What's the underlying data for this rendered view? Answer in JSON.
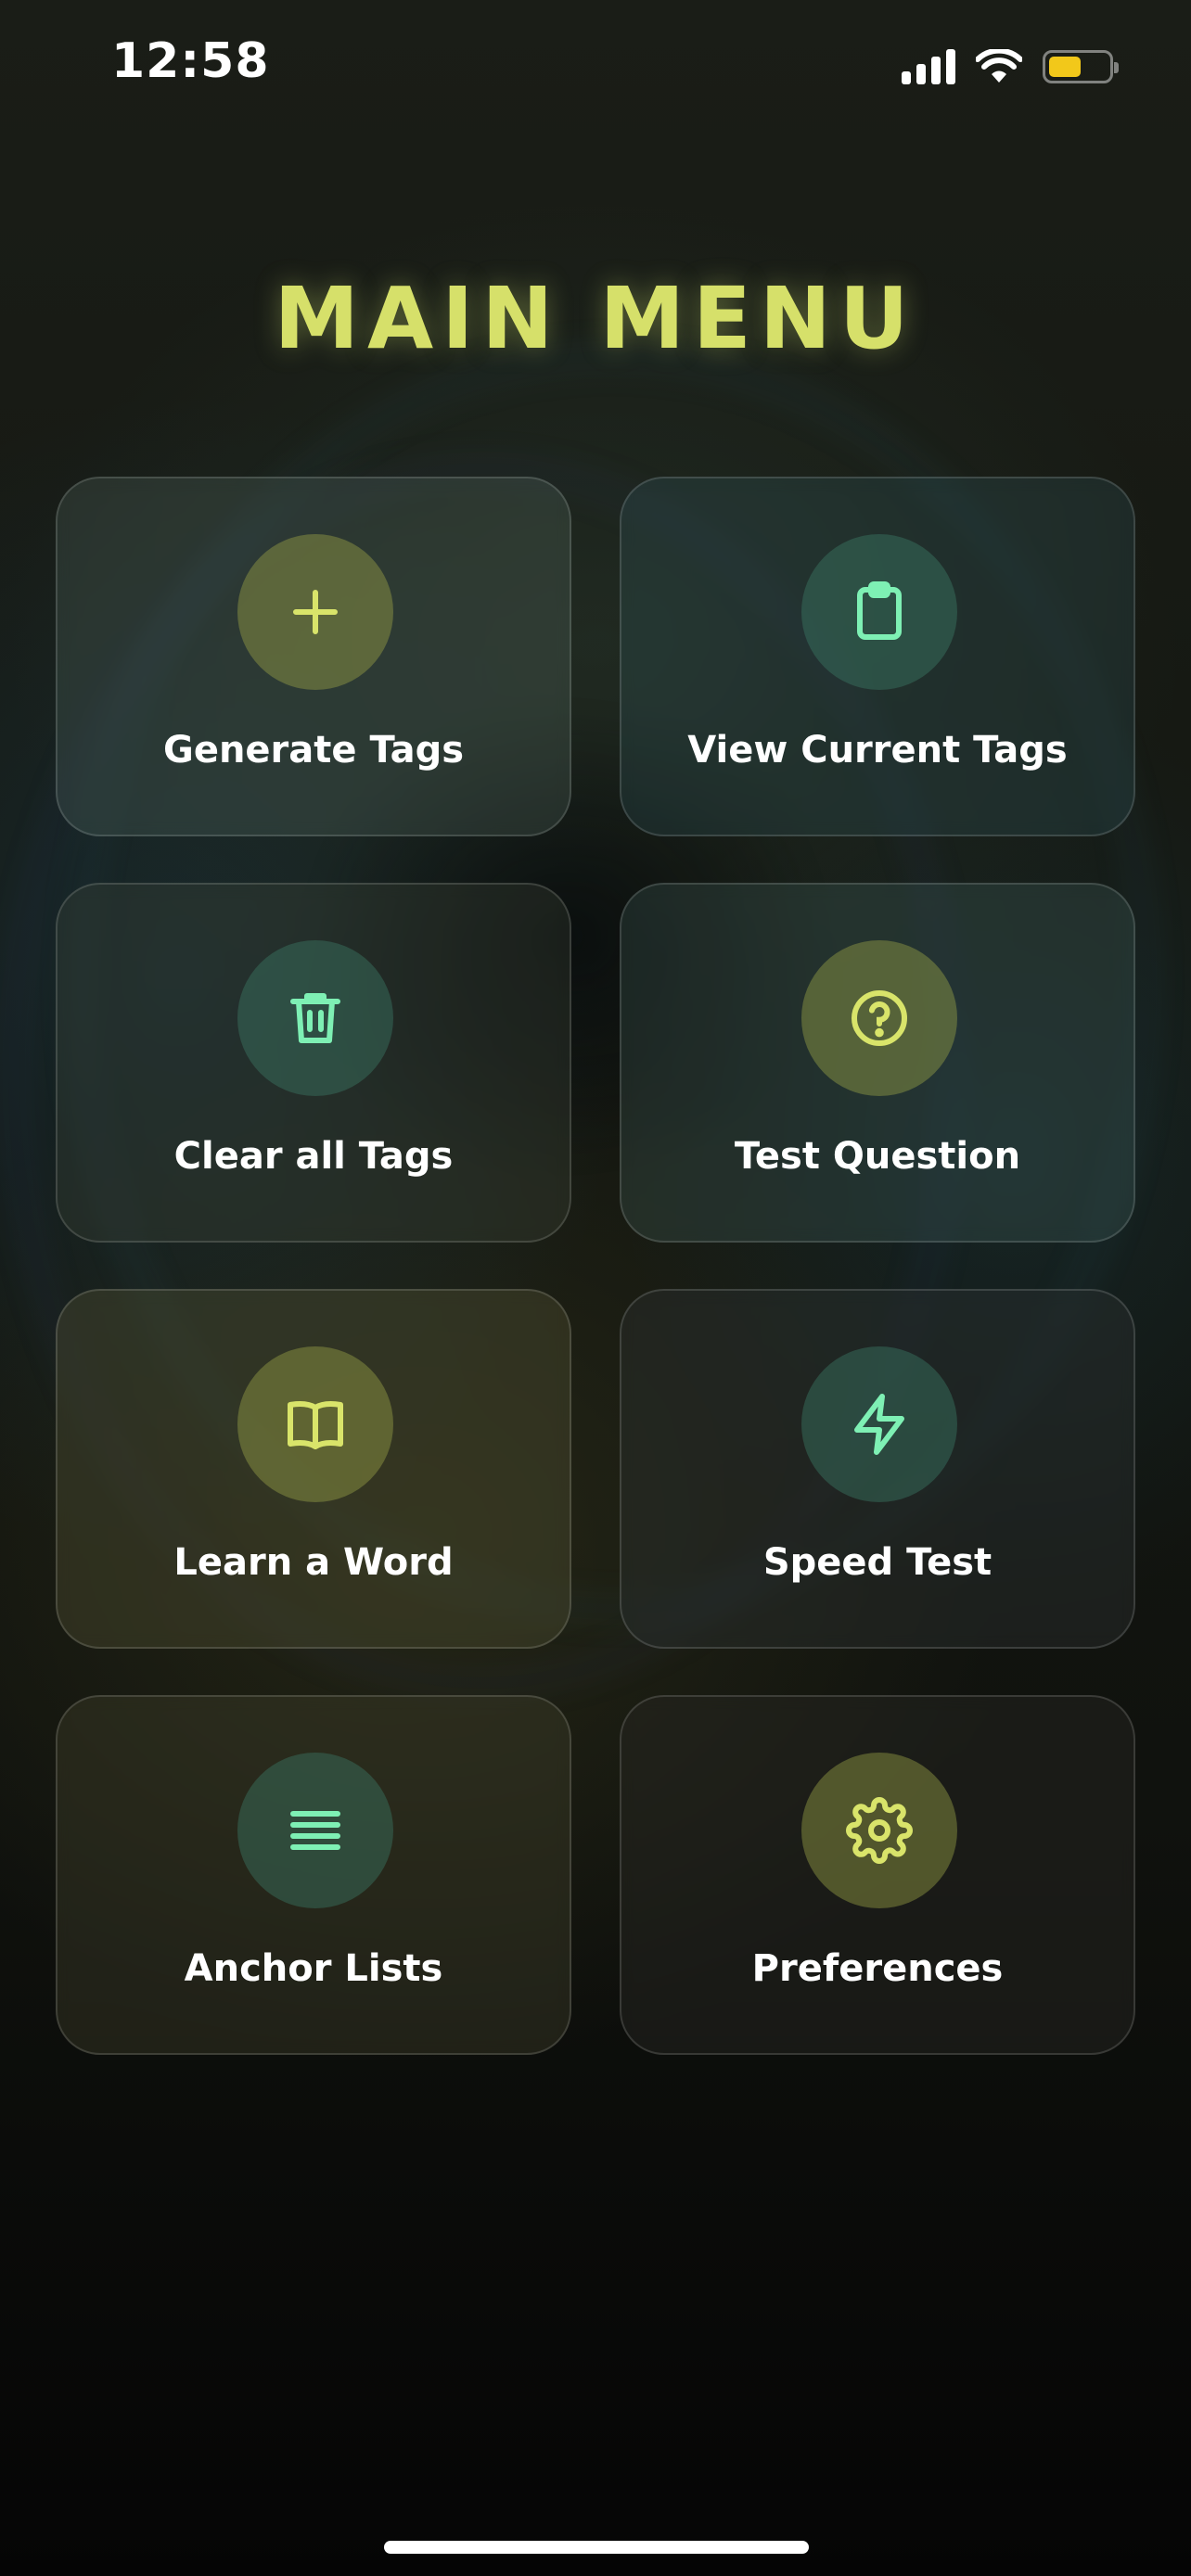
{
  "status_bar": {
    "time": "12:58",
    "battery_color": "#f2c81a"
  },
  "title": "MAIN MENU",
  "colors": {
    "title": "#d6e06a",
    "icon_yellow": "#d9e46a",
    "icon_green": "#7ef0b4"
  },
  "menu": {
    "items": [
      {
        "label": "Generate Tags",
        "icon": "plus-icon",
        "accent": "yellow"
      },
      {
        "label": "View Current Tags",
        "icon": "clipboard-icon",
        "accent": "green"
      },
      {
        "label": "Clear all Tags",
        "icon": "trash-icon",
        "accent": "green"
      },
      {
        "label": "Test Question",
        "icon": "question-circle-icon",
        "accent": "yellow"
      },
      {
        "label": "Learn a Word",
        "icon": "book-icon",
        "accent": "yellow"
      },
      {
        "label": "Speed Test",
        "icon": "lightning-icon",
        "accent": "green"
      },
      {
        "label": "Anchor Lists",
        "icon": "list-icon",
        "accent": "green"
      },
      {
        "label": "Preferences",
        "icon": "gear-icon",
        "accent": "yellow"
      }
    ]
  }
}
